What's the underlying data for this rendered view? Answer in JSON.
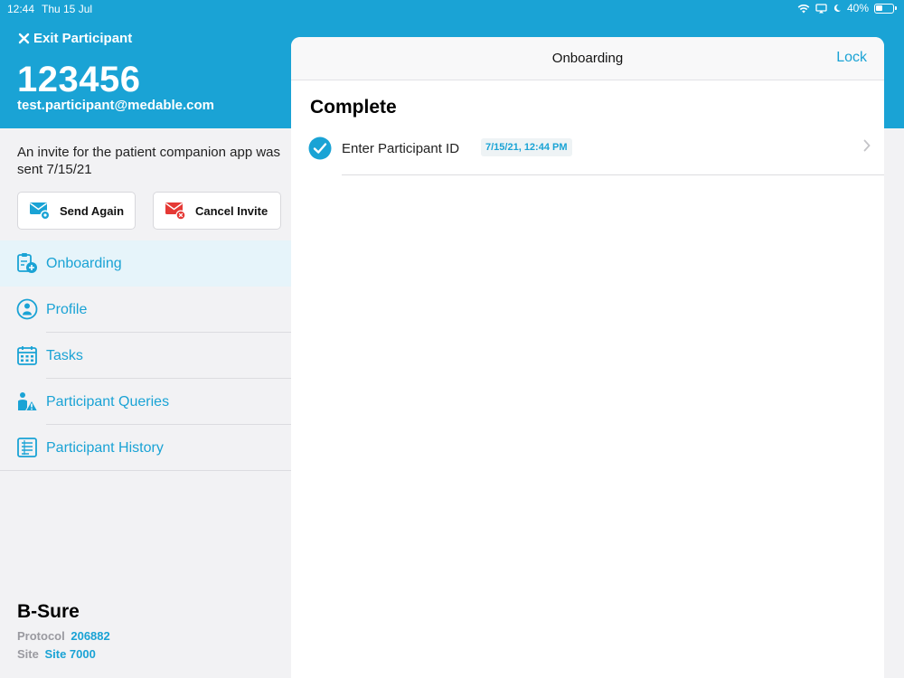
{
  "status_bar": {
    "time": "12:44",
    "date": "Thu 15 Jul",
    "battery": "40%"
  },
  "header": {
    "exit_label": "Exit Participant",
    "participant_id": "123456",
    "participant_email": "test.participant@medable.com"
  },
  "invite": {
    "message": "An invite for the patient companion app was sent 7/15/21",
    "send_again_label": "Send Again",
    "cancel_invite_label": "Cancel Invite"
  },
  "nav": {
    "items": [
      {
        "label": "Onboarding",
        "icon": "clipboard-plus-icon",
        "active": true
      },
      {
        "label": "Profile",
        "icon": "profile-icon",
        "active": false
      },
      {
        "label": "Tasks",
        "icon": "calendar-icon",
        "active": false
      },
      {
        "label": "Participant Queries",
        "icon": "person-alert-icon",
        "active": false
      },
      {
        "label": "Participant History",
        "icon": "history-list-icon",
        "active": false
      }
    ]
  },
  "study": {
    "name": "B-Sure",
    "protocol_label": "Protocol",
    "protocol_value": "206882",
    "site_label": "Site",
    "site_value": "Site 7000"
  },
  "panel": {
    "title": "Onboarding",
    "lock_label": "Lock",
    "section_title": "Complete",
    "tasks": [
      {
        "label": "Enter Participant ID",
        "timestamp": "7/15/21, 12:44 PM",
        "status": "complete"
      }
    ]
  },
  "colors": {
    "accent": "#1aa3d5",
    "danger": "#e53935",
    "background": "#f2f2f4"
  }
}
